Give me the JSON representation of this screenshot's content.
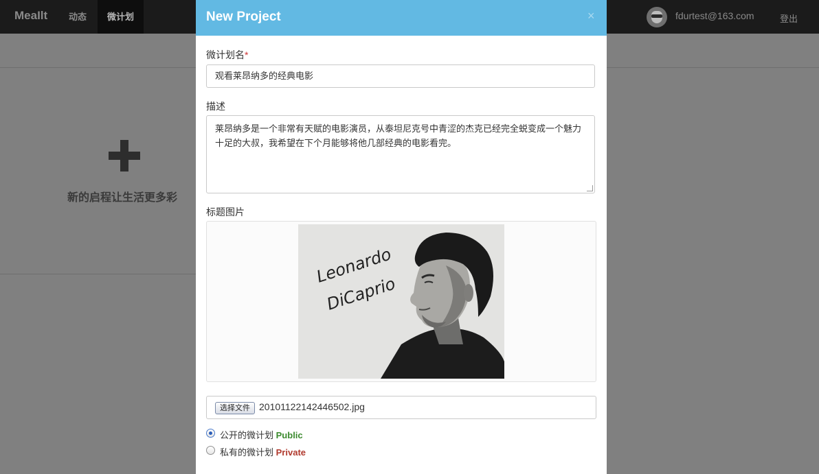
{
  "navbar": {
    "brand": "MeaIlt",
    "items": [
      {
        "label": "动态"
      },
      {
        "label": "微计划"
      }
    ],
    "user_email": "fdurtest@163.com",
    "logout_label": "登出"
  },
  "background_card": {
    "text": "新的启程让生活更多彩",
    "icon": "plus-icon"
  },
  "modal": {
    "title": "New Project",
    "close_label": "×",
    "name_label": "微计划名",
    "required_mark": "*",
    "name_value": "观看莱昂纳多的经典电影",
    "desc_label": "描述",
    "desc_value": "莱昂纳多是一个非常有天赋的电影演员，从泰坦尼克号中青涩的杰克已经完全蜕变成一个魅力十足的大叔，我希望在下个月能够将他几部经典的电影看完。",
    "image_label": "标题图片",
    "image_caption_line1": "Leonardo",
    "image_caption_line2": "DiCaprio",
    "file_button_label": "选择文件",
    "file_name": "20101122142446502.jpg",
    "radio_public_label": "公开的微计划",
    "radio_public_tag": "Public",
    "radio_private_label": "私有的微计划",
    "radio_private_tag": "Private",
    "selected_visibility": "Public"
  },
  "colors": {
    "header": "#62b9e3",
    "public": "#3b8a2e",
    "private": "#b03a2e"
  }
}
